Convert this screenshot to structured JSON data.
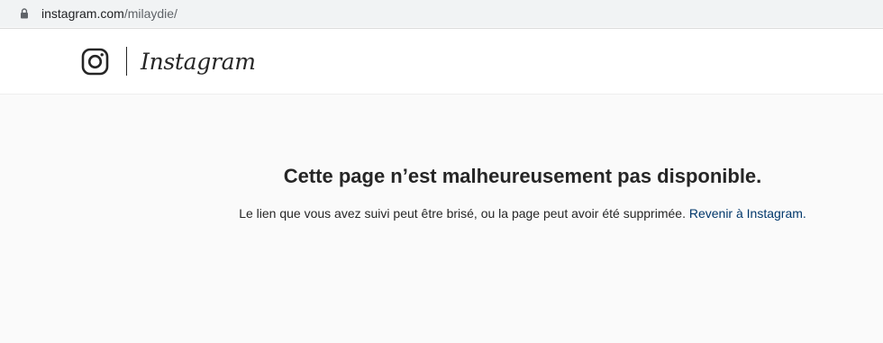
{
  "browser": {
    "url_host": "instagram.com",
    "url_path": "/milaydie/"
  },
  "header": {
    "logo_icon": "instagram-camera-icon",
    "wordmark": "Instagram"
  },
  "error": {
    "title": "Cette page n’est malheureusement pas disponible.",
    "message": "Le lien que vous avez suivi peut être brisé, ou la page peut avoir été supprimée.",
    "link_label": "Revenir à Instagram."
  },
  "colors": {
    "link": "#00376b",
    "text": "#262626",
    "background": "#fafafa"
  }
}
